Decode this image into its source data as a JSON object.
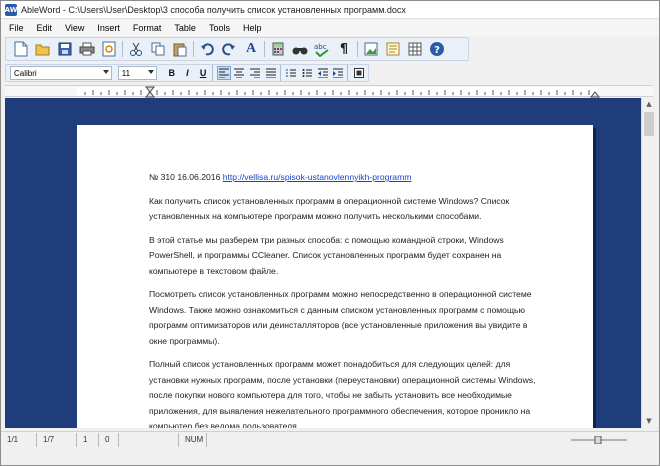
{
  "window": {
    "title": "AbleWord - C:\\Users\\User\\Desktop\\3 способа получить список установленных программ.docx",
    "icon_label": "AW"
  },
  "menu": [
    "File",
    "Edit",
    "View",
    "Insert",
    "Format",
    "Table",
    "Tools",
    "Help"
  ],
  "toolbar": {
    "icons": [
      "new-document-icon",
      "open-folder-icon",
      "save-icon",
      "print-icon",
      "print-preview-icon",
      "cut-icon",
      "copy-icon",
      "paste-icon",
      "undo-icon",
      "redo-icon",
      "font-icon",
      "calculator-icon",
      "find-icon",
      "spell-check-icon",
      "paragraph-mark-icon",
      "insert-image-icon",
      "page-layout-icon",
      "insert-table-icon",
      "help-icon"
    ],
    "font_button_label": "A",
    "spell_label": "abc",
    "paragraph_label": "¶",
    "help_label": "?"
  },
  "format": {
    "font_name": "Calibri",
    "font_size": "11",
    "bold_label": "B",
    "italic_label": "I",
    "underline_label": "U"
  },
  "document": {
    "first_line_prefix": "№ 310 16.06.2016 ",
    "first_line_link": "http://vellisa.ru/spisok-ustanovlennyikh-programm",
    "paragraphs": [
      "Как получить список установленных программ в операционной системе Windows? Список установленных на компьютере программ можно получить несколькими способами.",
      "В этой статье мы разберем три разных способа: с помощью командной строки, Windows PowerShell, и программы CCleaner. Список установленных программ будет сохранен на компьютере в текстовом файле.",
      "Посмотреть список установленных программ можно непосредственно в операционной системе Windows. Также можно ознакомиться с данным списком установленных программ с помощью программ оптимизаторов  или деинсталляторов (все установленные приложения вы увидите в окне программы).",
      "Полный список установленных программ может понадобиться для следующих целей: для установки нужных программ, после установки (переустановки) операционной системы Windows, после покупки нового компьютера для того, чтобы не забыть установить все необходимые приложения, для выявления нежелательного программного обеспечения, которое проникло на компьютер без ведома пользователя."
    ]
  },
  "status": {
    "page": "1/1",
    "section": "1/7",
    "column": "1",
    "line": "0",
    "num_lock": "NUM"
  },
  "colors": {
    "doc_background": "#1f3d7a",
    "link": "#1a44c7"
  }
}
